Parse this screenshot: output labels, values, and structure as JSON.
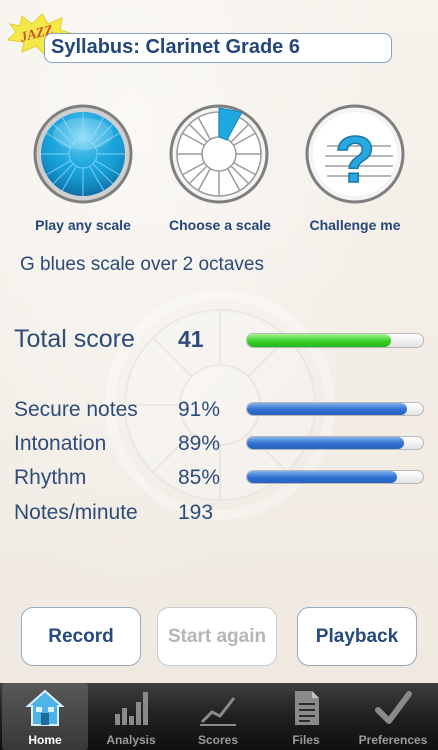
{
  "header": {
    "badge": "JAZZ",
    "syllabus": "Syllabus: Clarinet Grade 6"
  },
  "modes": [
    {
      "label": "Play any scale",
      "icon": "scale-wheel-icon"
    },
    {
      "label": "Choose a scale",
      "icon": "segment-wheel-icon"
    },
    {
      "label": "Challenge me",
      "icon": "question-mark-icon"
    }
  ],
  "scale_description": "G blues scale over 2 octaves",
  "total": {
    "label": "Total score",
    "value": "41",
    "progress": 0.82,
    "color": "#38cf2a"
  },
  "stats": [
    {
      "label": "Secure notes",
      "value": "91%",
      "progress": 0.91
    },
    {
      "label": "Intonation",
      "value": "89%",
      "progress": 0.89
    },
    {
      "label": "Rhythm",
      "value": "85%",
      "progress": 0.85
    },
    {
      "label": "Notes/minute",
      "value": "193"
    }
  ],
  "actions": {
    "record": "Record",
    "start_again": "Start again",
    "playback": "Playback"
  },
  "tabs": [
    {
      "label": "Home",
      "icon": "home-icon",
      "active": true
    },
    {
      "label": "Analysis",
      "icon": "bar-chart-icon",
      "active": false
    },
    {
      "label": "Scores",
      "icon": "trend-chart-icon",
      "active": false
    },
    {
      "label": "Files",
      "icon": "document-icon",
      "active": false
    },
    {
      "label": "Preferences",
      "icon": "checkmark-icon",
      "active": false
    }
  ],
  "colors": {
    "accent": "#24467a",
    "progress_blue": "#2f6fd0",
    "progress_green": "#38cf2a"
  }
}
